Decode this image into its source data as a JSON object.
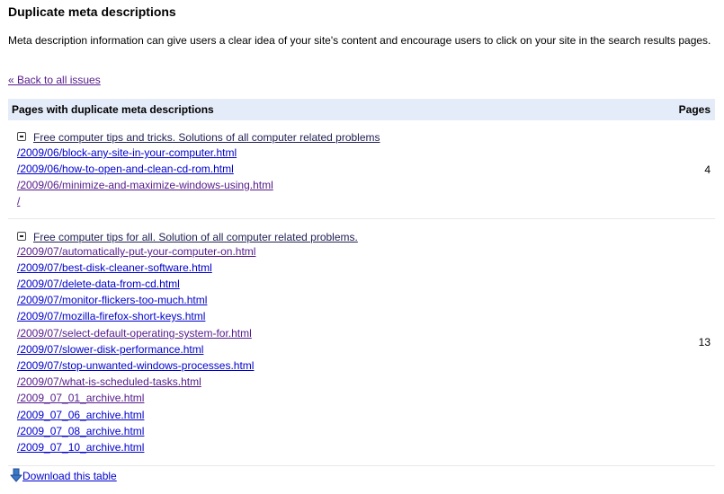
{
  "page": {
    "title": "Duplicate meta descriptions",
    "description": "Meta description information can give users a clear idea of your site's content and encourage users to click on your site in the search results pages.",
    "back_link": "« Back to all issues"
  },
  "table": {
    "header_left": "Pages with duplicate meta descriptions",
    "header_right": "Pages",
    "groups": [
      {
        "title": "Free computer tips and tricks. Solutions of all computer related problems",
        "count": "4",
        "links": [
          "/2009/06/block-any-site-in-your-computer.html",
          "/2009/06/how-to-open-and-clean-cd-rom.html",
          "/2009/06/minimize-and-maximize-windows-using.html",
          "/"
        ]
      },
      {
        "title": "Free computer tips for all. Solution of all computer related problems.",
        "count": "13",
        "links": [
          "/2009/07/automatically-put-your-computer-on.html",
          "/2009/07/best-disk-cleaner-software.html",
          "/2009/07/delete-data-from-cd.html",
          "/2009/07/monitor-flickers-too-much.html",
          "/2009/07/mozilla-firefox-short-keys.html",
          "/2009/07/select-default-operating-system-for.html",
          "/2009/07/slower-disk-performance.html",
          "/2009/07/stop-unwanted-windows-processes.html",
          "/2009/07/what-is-scheduled-tasks.html",
          "/2009_07_01_archive.html",
          "/2009_07_06_archive.html",
          "/2009_07_08_archive.html",
          "/2009_07_10_archive.html"
        ]
      }
    ]
  },
  "footer": {
    "download_label": "Download this table",
    "download_icon": "download-arrow-icon"
  },
  "colors": {
    "link": "#0000cc",
    "visited_link": "#551a8b",
    "header_bg": "#e5ecf9"
  }
}
